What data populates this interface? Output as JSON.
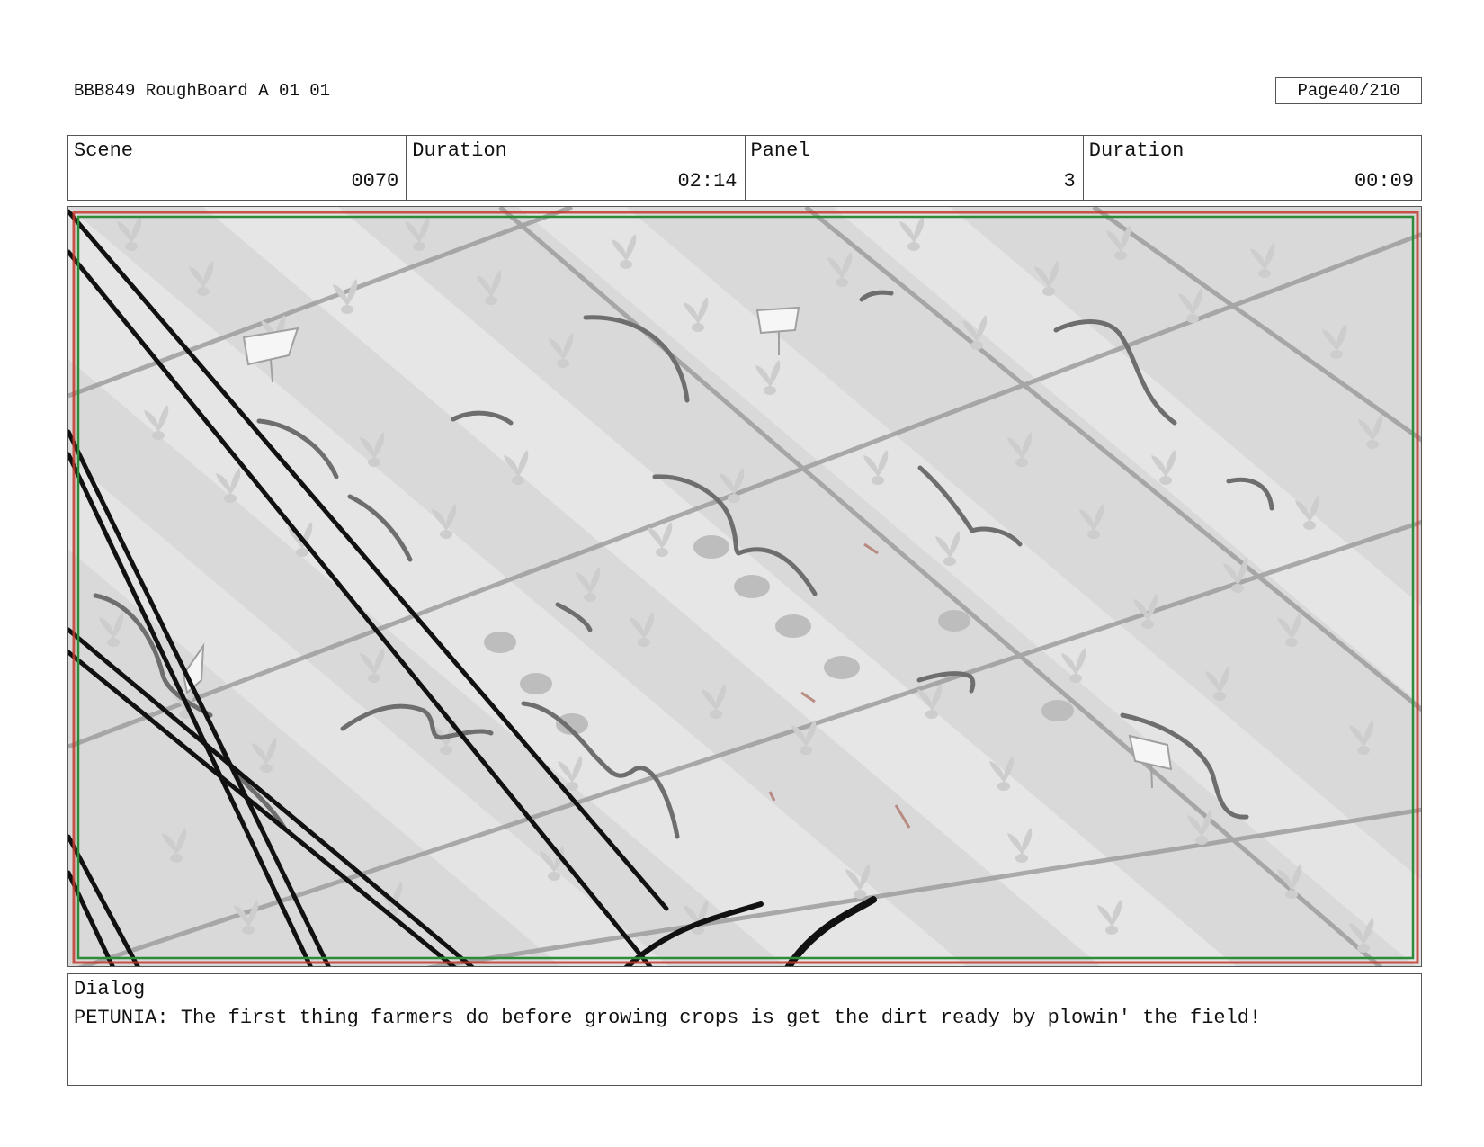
{
  "header": {
    "title": "BBB849 RoughBoard A 01 01",
    "page_label": "Page",
    "page_value": "40/210"
  },
  "info": {
    "scene_label": "Scene",
    "scene_value": "0070",
    "scene_duration_label": "Duration",
    "scene_duration_value": "02:14",
    "panel_label": "Panel",
    "panel_value": "3",
    "panel_duration_label": "Duration",
    "panel_duration_value": "00:09"
  },
  "dialog": {
    "label": "Dialog",
    "text": "PETUNIA: The first thing farmers do before growing crops is get the dirt ready by plowin' the field!"
  },
  "colors": {
    "frame_red": "#c0392b",
    "frame_green": "#2e8b3a",
    "sketch_dark": "#111111",
    "sketch_gray": "#777777",
    "field_light": "#e2e2e2",
    "field_mid": "#cfcfcf"
  }
}
